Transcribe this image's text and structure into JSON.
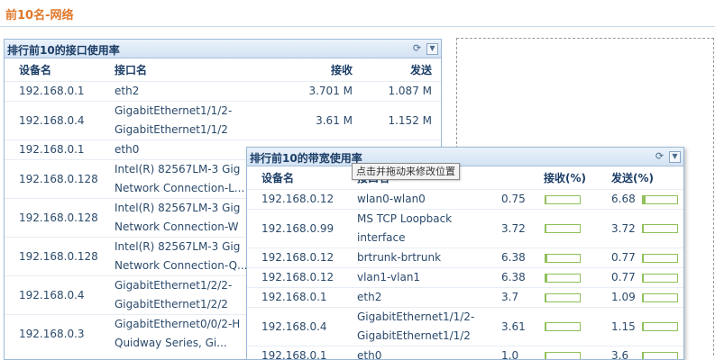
{
  "page": {
    "title": "前10名-网络"
  },
  "interface_panel": {
    "title": "排行前10的接口使用率",
    "columns": {
      "device": "设备名",
      "interface": "接口名",
      "recv": "接收",
      "send": "发送"
    },
    "rows": [
      {
        "device": "192.168.0.1",
        "if1": "eth2",
        "if2": "",
        "recv": "3.701 M",
        "send": "1.087 M"
      },
      {
        "device": "192.168.0.4",
        "if1": "GigabitEthernet1/1/2-",
        "if2": "GigabitEthernet1/1/2",
        "recv": "3.61 M",
        "send": "1.152 M"
      },
      {
        "device": "192.168.0.1",
        "if1": "eth0",
        "if2": "",
        "recv": "",
        "send": ""
      },
      {
        "device": "192.168.0.128",
        "if1": "Intel(R) 82567LM-3 Gig",
        "if2": "Network Connection-L...",
        "recv": "",
        "send": ""
      },
      {
        "device": "192.168.0.128",
        "if1": "Intel(R) 82567LM-3 Gig",
        "if2": "Network Connection-W",
        "recv": "",
        "send": ""
      },
      {
        "device": "192.168.0.128",
        "if1": "Intel(R) 82567LM-3 Gig",
        "if2": "Network Connection-Q...",
        "recv": "",
        "send": ""
      },
      {
        "device": "192.168.0.4",
        "if1": "GigabitEthernet1/2/2-",
        "if2": "GigabitEthernet1/2/2",
        "recv": "",
        "send": ""
      },
      {
        "device": "192.168.0.3",
        "if1": "GigabitEthernet0/0/2-H",
        "if2": "Quidway Series, Gi...",
        "recv": "",
        "send": ""
      }
    ]
  },
  "bandwidth_panel": {
    "title": "排行前10的带宽使用率",
    "tooltip": "点击并拖动来修改位置",
    "columns": {
      "device": "设备名",
      "interface": "接口名",
      "recv": "接收(%)",
      "send": "发送(%)"
    },
    "rows": [
      {
        "device": "192.168.0.12",
        "if1": "wlan0-wlan0",
        "if2": "",
        "recv": "0.75",
        "send": "6.68",
        "recv_pct": 0.75,
        "send_pct": 6.68
      },
      {
        "device": "192.168.0.99",
        "if1": "MS TCP Loopback",
        "if2": "interface",
        "recv": "3.72",
        "send": "3.72",
        "recv_pct": 3.72,
        "send_pct": 3.72
      },
      {
        "device": "192.168.0.12",
        "if1": "brtrunk-brtrunk",
        "if2": "",
        "recv": "6.38",
        "send": "0.77",
        "recv_pct": 6.38,
        "send_pct": 0.77
      },
      {
        "device": "192.168.0.12",
        "if1": "vlan1-vlan1",
        "if2": "",
        "recv": "6.38",
        "send": "0.77",
        "recv_pct": 6.38,
        "send_pct": 0.77
      },
      {
        "device": "192.168.0.1",
        "if1": "eth2",
        "if2": "",
        "recv": "3.7",
        "send": "1.09",
        "recv_pct": 3.7,
        "send_pct": 1.09
      },
      {
        "device": "192.168.0.4",
        "if1": "GigabitEthernet1/1/2-",
        "if2": "GigabitEthernet1/1/2",
        "recv": "3.61",
        "send": "1.15",
        "recv_pct": 3.61,
        "send_pct": 1.15
      },
      {
        "device": "192.168.0.1",
        "if1": "eth0",
        "if2": "",
        "recv": "1.0",
        "send": "3.6",
        "recv_pct": 1.0,
        "send_pct": 3.6
      }
    ]
  },
  "icons": {
    "refresh": "refresh-icon",
    "collapse": "collapse-icon"
  }
}
